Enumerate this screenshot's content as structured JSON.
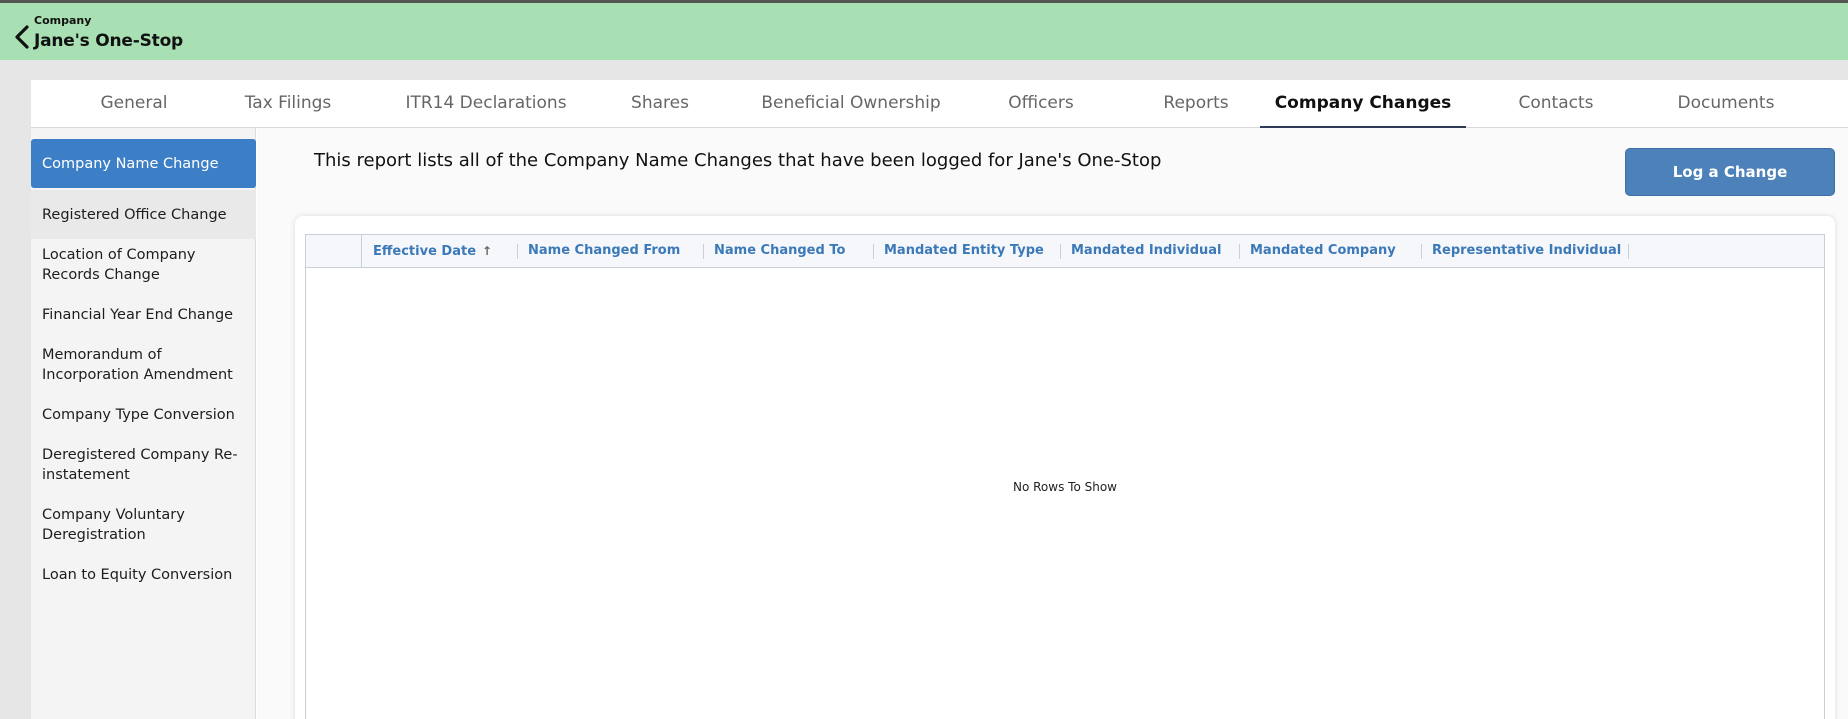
{
  "header": {
    "back_icon": "chevron-left-icon",
    "subtitle": "Company",
    "title": "Jane's One-Stop"
  },
  "tabs": [
    {
      "label": "General"
    },
    {
      "label": "Tax Filings"
    },
    {
      "label": "ITR14 Declarations"
    },
    {
      "label": "Shares"
    },
    {
      "label": "Beneficial Ownership"
    },
    {
      "label": "Officers"
    },
    {
      "label": "Reports"
    },
    {
      "label": "Company Changes",
      "active": true
    },
    {
      "label": "Contacts"
    },
    {
      "label": "Documents"
    }
  ],
  "sidebar": {
    "items": [
      {
        "label": "Company Name Change",
        "active": true
      },
      {
        "label": "Registered Office Change"
      },
      {
        "label": "Location of Company Records Change"
      },
      {
        "label": "Financial Year End Change"
      },
      {
        "label": "Memorandum of Incorporation Amendment"
      },
      {
        "label": "Company Type Conversion"
      },
      {
        "label": "Deregistered Company Re-instatement"
      },
      {
        "label": "Company Voluntary Deregistration"
      },
      {
        "label": "Loan to Equity Conversion"
      }
    ]
  },
  "main": {
    "intro": "This report lists all of the Company Name Changes that have been logged for Jane's One-Stop",
    "log_button": "Log a Change",
    "table": {
      "columns": [
        {
          "label": "Effective Date",
          "sort": "ascending"
        },
        {
          "label": "Name Changed From"
        },
        {
          "label": "Name Changed To"
        },
        {
          "label": "Mandated Entity Type"
        },
        {
          "label": "Mandated Individual"
        },
        {
          "label": "Mandated Company"
        },
        {
          "label": "Representative Individual"
        }
      ],
      "sort_glyph": "↑",
      "empty_text": "No Rows To Show"
    }
  },
  "colors": {
    "header_bg": "#a8dfb3",
    "accent_blue": "#3d7fc6",
    "button_blue": "#4d81b9",
    "column_header_text": "#3b79b8",
    "active_tab_underline": "#2f3b55"
  }
}
